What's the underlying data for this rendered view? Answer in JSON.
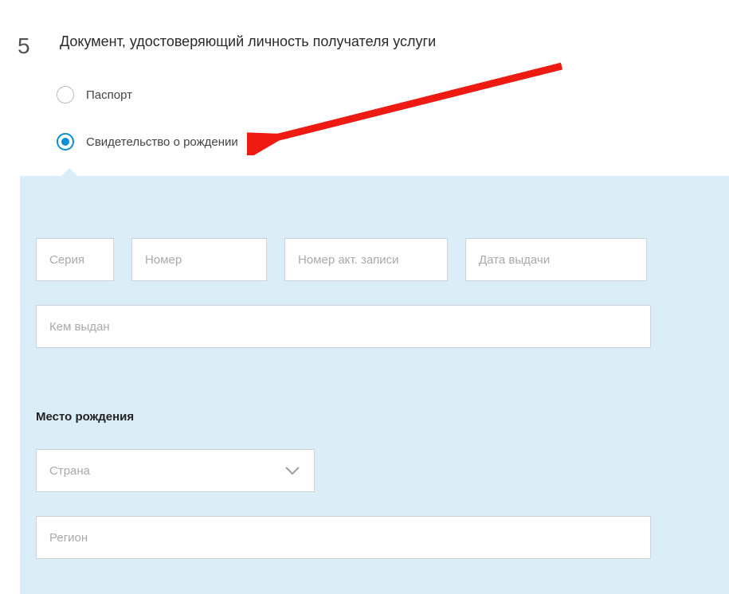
{
  "step": {
    "number": "5",
    "title": "Документ, удостоверяющий личность получателя услуги"
  },
  "radio": {
    "passport": "Паспорт",
    "birth_cert": "Свидетельство о рождении"
  },
  "fields": {
    "series_ph": "Серия",
    "number_ph": "Номер",
    "act_record_ph": "Номер акт. записи",
    "issue_date_ph": "Дата выдачи",
    "issued_by_ph": "Кем выдан",
    "country_ph": "Страна",
    "region_ph": "Регион"
  },
  "subheading": "Место рождения"
}
